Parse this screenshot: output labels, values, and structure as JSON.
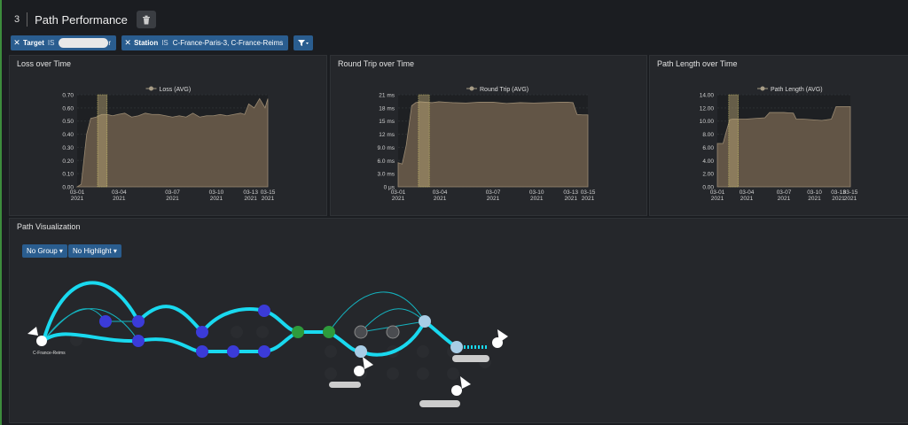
{
  "section": {
    "number": "3",
    "title": "Path Performance",
    "delete_icon": "trash-icon"
  },
  "filters": [
    {
      "key": "Target",
      "op": "IS",
      "value_suffix": "r"
    },
    {
      "key": "Station",
      "op": "IS",
      "value": "C-France-Paris-3,  C-France-Reims"
    }
  ],
  "panels": {
    "loss": {
      "title": "Loss over Time"
    },
    "rtt": {
      "title": "Round Trip over Time"
    },
    "len": {
      "title": "Path Length over Time"
    },
    "viz": {
      "title": "Path Visualization",
      "group_label": "No Group",
      "highlight_label": "No Highlight",
      "origin_label": "C-France-Reims"
    }
  },
  "chart_data": [
    {
      "type": "area",
      "title": "Loss over Time",
      "legend": "Loss (AVG)",
      "ylim": [
        0,
        0.7
      ],
      "yticks": [
        "0.00",
        "0.10",
        "0.20",
        "0.30",
        "0.40",
        "0.50",
        "0.60",
        "0.70"
      ],
      "xticks": [
        [
          "03-01",
          "2021"
        ],
        [
          "03-04",
          "2021"
        ],
        [
          "03-07",
          "2021"
        ],
        [
          "03-10",
          "2021"
        ],
        [
          "03-13",
          "2021"
        ],
        [
          "03-15",
          "2021"
        ]
      ],
      "x": [
        0,
        0.3,
        0.7,
        1,
        1.4,
        1.8,
        2.2,
        2.6,
        3,
        3.5,
        4,
        4.5,
        5,
        5.5,
        6,
        6.5,
        7,
        7.5,
        8,
        8.5,
        9,
        9.5,
        10,
        10.5,
        11,
        11.5,
        12,
        12.3,
        12.6,
        13,
        13.4,
        13.8,
        14
      ],
      "y": [
        0,
        0.02,
        0.4,
        0.52,
        0.53,
        0.55,
        0.55,
        0.54,
        0.55,
        0.56,
        0.53,
        0.54,
        0.56,
        0.55,
        0.55,
        0.54,
        0.53,
        0.54,
        0.53,
        0.56,
        0.53,
        0.54,
        0.54,
        0.55,
        0.54,
        0.55,
        0.56,
        0.55,
        0.63,
        0.6,
        0.67,
        0.6,
        0.67
      ],
      "highlight": [
        1.5,
        2.2
      ]
    },
    {
      "type": "area",
      "title": "Round Trip over Time",
      "legend": "Round Trip (AVG)",
      "ylim": [
        0,
        21
      ],
      "yticks": [
        "0 μs",
        "3.0 ms",
        "6.0 ms",
        "9.0 ms",
        "12 ms",
        "15 ms",
        "18 ms",
        "21 ms"
      ],
      "xticks": [
        [
          "03-01",
          "2021"
        ],
        [
          "03-04",
          "2021"
        ],
        [
          "03-07",
          "2021"
        ],
        [
          "03-10",
          "2021"
        ],
        [
          "03-13",
          "2021"
        ],
        [
          "03-15",
          "2021"
        ]
      ],
      "x": [
        0,
        0.3,
        0.6,
        1,
        1.3,
        1.6,
        2,
        2.5,
        3,
        4,
        5,
        6,
        7,
        8,
        9,
        10,
        11,
        12,
        12.5,
        12.9,
        13.2,
        13.6,
        14
      ],
      "y": [
        5.5,
        5.2,
        9.5,
        18.5,
        19.2,
        19.4,
        19.3,
        19.2,
        19.4,
        19.2,
        19.1,
        19.3,
        19.3,
        19.0,
        19.2,
        19.1,
        19.2,
        19.3,
        19.3,
        19.2,
        16.5,
        16.4,
        16.4
      ],
      "highlight": [
        1.5,
        2.3
      ]
    },
    {
      "type": "area",
      "title": "Path Length over Time",
      "legend": "Path Length (AVG)",
      "ylim": [
        0,
        14
      ],
      "yticks": [
        "0.00",
        "2.00",
        "4.00",
        "6.00",
        "8.00",
        "10.00",
        "12.00",
        "14.00"
      ],
      "xticks": [
        [
          "03-01",
          "2021"
        ],
        [
          "03-04",
          "2021"
        ],
        [
          "03-07",
          "2021"
        ],
        [
          "03-10",
          "2021"
        ],
        [
          "03-13",
          "2021"
        ],
        [
          "03-15",
          "2021"
        ]
      ],
      "x": [
        0,
        0.2,
        0.6,
        0.9,
        1.3,
        1.6,
        2,
        3,
        4,
        5,
        5.5,
        6,
        7,
        8,
        8.3,
        9,
        10,
        11,
        12,
        12.5,
        13,
        14
      ],
      "y": [
        6.6,
        6.6,
        6.6,
        8.2,
        10.2,
        10.3,
        10.3,
        10.3,
        10.4,
        10.5,
        11.3,
        11.3,
        11.3,
        11.2,
        10.3,
        10.3,
        10.2,
        10.1,
        10.3,
        12.2,
        12.2,
        12.2
      ],
      "highlight": [
        1.2,
        2.2
      ]
    }
  ]
}
